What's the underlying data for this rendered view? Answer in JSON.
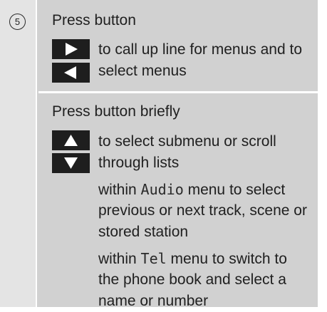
{
  "row1": {
    "number": "5",
    "instruction": "Press button",
    "keys": [
      {
        "icon": "arrow-right-icon"
      },
      {
        "icon": "arrow-left-icon"
      }
    ],
    "description_line1": "to call up line for menus and to",
    "description_line2": "select menus"
  },
  "row2": {
    "instruction": "Press button briefly",
    "keys": [
      {
        "icon": "arrow-up-icon"
      },
      {
        "icon": "arrow-down-icon"
      }
    ],
    "description_line1": "to select submenu or scroll",
    "description_line2": "through lists",
    "audio": {
      "prefix": "within ",
      "menu": "Audio",
      "suffix": " menu to select",
      "line2": "previous or next track, scene or",
      "line3": "stored station"
    },
    "tel": {
      "prefix": "within ",
      "menu": "Tel",
      "suffix": " menu to switch to",
      "line2": "the phone book and select a",
      "line3": "name or number"
    }
  },
  "colors": {
    "number_column": "#e4e4e4",
    "body_column": "#d1d1d1",
    "key_fill": "#1e1e1e",
    "arrow_fill": "#ffffff"
  }
}
